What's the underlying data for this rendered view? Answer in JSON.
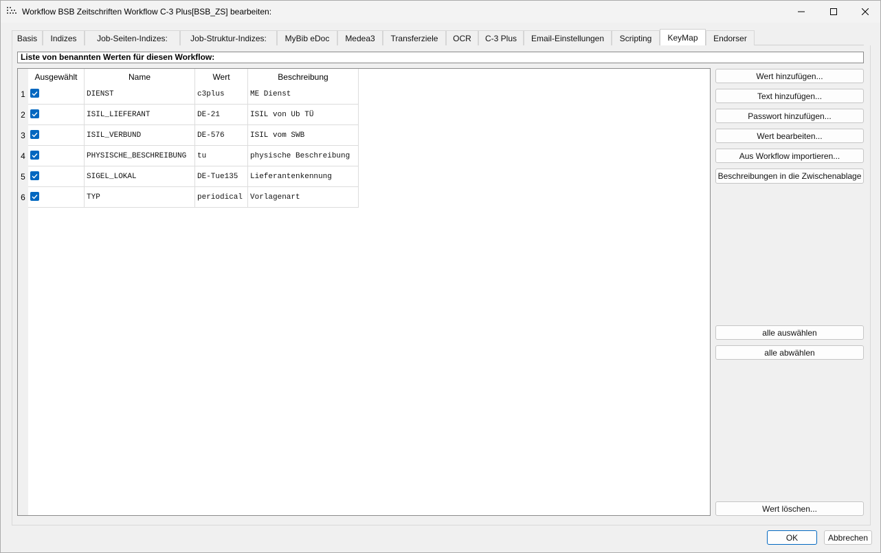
{
  "window": {
    "title": "Workflow BSB Zeitschriften Workflow C-3 Plus[BSB_ZS] bearbeiten:",
    "accent_color": "#0067c0"
  },
  "tabs": [
    {
      "label": "Basis",
      "active": false
    },
    {
      "label": "Indizes",
      "active": false
    },
    {
      "label": "Job-Seiten-Indizes:",
      "active": false
    },
    {
      "label": "Job-Struktur-Indizes:",
      "active": false
    },
    {
      "label": "MyBib eDoc",
      "active": false
    },
    {
      "label": "Medea3",
      "active": false
    },
    {
      "label": "Transferziele",
      "active": false
    },
    {
      "label": "OCR",
      "active": false
    },
    {
      "label": "C-3 Plus",
      "active": false
    },
    {
      "label": "Email-Einstellungen",
      "active": false
    },
    {
      "label": "Scripting",
      "active": false
    },
    {
      "label": "KeyMap",
      "active": true
    },
    {
      "label": "Endorser",
      "active": false
    }
  ],
  "section": {
    "label": "Liste von benannten Werten für diesen Workflow:"
  },
  "table": {
    "columns": [
      "Ausgewählt",
      "Name",
      "Wert",
      "Beschreibung"
    ],
    "rows": [
      {
        "num": "1",
        "selected": true,
        "name": "DIENST",
        "value": "c3plus",
        "description": "ME Dienst"
      },
      {
        "num": "2",
        "selected": true,
        "name": "ISIL_LIEFERANT",
        "value": "DE-21",
        "description": "ISIL von Ub TÜ"
      },
      {
        "num": "3",
        "selected": true,
        "name": "ISIL_VERBUND",
        "value": "DE-576",
        "description": "ISIL vom SWB"
      },
      {
        "num": "4",
        "selected": true,
        "name": "PHYSISCHE_BESCHREIBUNG",
        "value": "tu",
        "description": "physische Beschreibung"
      },
      {
        "num": "5",
        "selected": true,
        "name": "SIGEL_LOKAL",
        "value": "DE-Tue135",
        "description": "Lieferantenkennung"
      },
      {
        "num": "6",
        "selected": true,
        "name": "TYP",
        "value": "periodical",
        "description": "Vorlagenart"
      }
    ]
  },
  "side_buttons": {
    "add_value": "Wert hinzufügen...",
    "add_text": "Text hinzufügen...",
    "add_password": "Passwort hinzufügen...",
    "edit_value": "Wert bearbeiten...",
    "import_workflow": "Aus Workflow importieren...",
    "copy_descriptions": "Beschreibungen in die Zwischenablage",
    "select_all": "alle auswählen",
    "deselect_all": "alle abwählen",
    "delete_value": "Wert löschen..."
  },
  "footer": {
    "ok": "OK",
    "cancel": "Abbrechen"
  }
}
